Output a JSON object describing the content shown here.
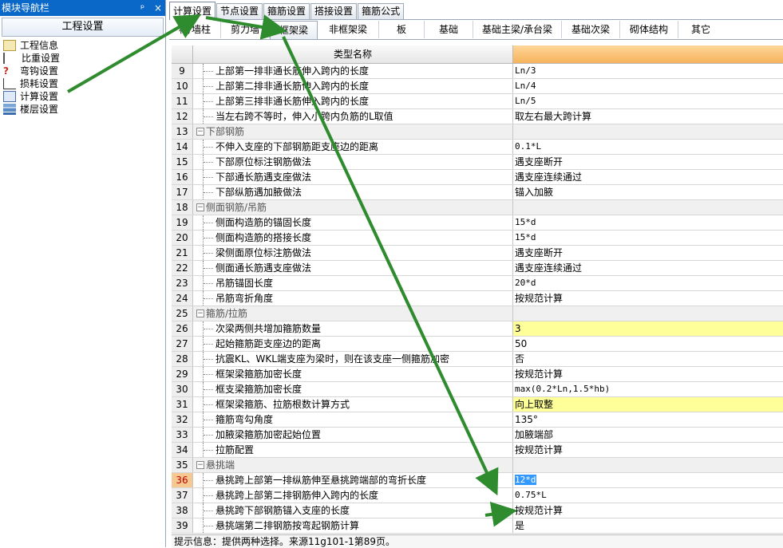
{
  "nav": {
    "title": "模块导航栏",
    "pin": "ᵖ",
    "close": "×",
    "section": "工程设置",
    "items": [
      {
        "label": "工程信息",
        "icon": "document-icon"
      },
      {
        "label": "比重设置",
        "icon": "scale-icon"
      },
      {
        "label": "弯钩设置",
        "icon": "hook-icon"
      },
      {
        "label": "损耗设置",
        "icon": "chart-icon"
      },
      {
        "label": "计算设置",
        "icon": "calculator-icon"
      },
      {
        "label": "楼层设置",
        "icon": "floors-icon"
      }
    ]
  },
  "tabs_top": [
    "计算设置",
    "节点设置",
    "箍筋设置",
    "搭接设置",
    "箍筋公式"
  ],
  "tabs_sub": [
    "柱/墙柱",
    "剪力墙",
    "框架梁",
    "非框架梁",
    "板",
    "基础",
    "基础主梁/承台梁",
    "基础次梁",
    "砌体结构",
    "其它"
  ],
  "grid": {
    "header": "类型名称",
    "rows": [
      {
        "num": "9",
        "name": "上部第一排非通长筋伸入跨内的长度",
        "value": "Ln/3"
      },
      {
        "num": "10",
        "name": "上部第二排非通长筋伸入跨内的长度",
        "value": "Ln/4"
      },
      {
        "num": "11",
        "name": "上部第三排非通长筋伸入跨内的长度",
        "value": "Ln/5"
      },
      {
        "num": "12",
        "name": "当左右跨不等时，伸入小跨内负筋的L取值",
        "value": "取左右最大跨计算"
      },
      {
        "num": "13",
        "name": "下部钢筋",
        "value": ""
      },
      {
        "num": "14",
        "name": "不伸入支座的下部钢筋距支座边的距离",
        "value": "0.1*L"
      },
      {
        "num": "15",
        "name": "下部原位标注钢筋做法",
        "value": "遇支座断开"
      },
      {
        "num": "16",
        "name": "下部通长筋遇支座做法",
        "value": "遇支座连续通过"
      },
      {
        "num": "17",
        "name": "下部纵筋遇加腋做法",
        "value": "锚入加腋"
      },
      {
        "num": "18",
        "name": "侧面钢筋/吊筋",
        "value": ""
      },
      {
        "num": "19",
        "name": "侧面构造筋的锚固长度",
        "value": "15*d"
      },
      {
        "num": "20",
        "name": "侧面构造筋的搭接长度",
        "value": "15*d"
      },
      {
        "num": "21",
        "name": "梁侧面原位标注筋做法",
        "value": "遇支座断开"
      },
      {
        "num": "22",
        "name": "侧面通长筋遇支座做法",
        "value": "遇支座连续通过"
      },
      {
        "num": "23",
        "name": "吊筋锚固长度",
        "value": "20*d"
      },
      {
        "num": "24",
        "name": "吊筋弯折角度",
        "value": "按规范计算"
      },
      {
        "num": "25",
        "name": "箍筋/拉筋",
        "value": ""
      },
      {
        "num": "26",
        "name": "次梁两侧共增加箍筋数量",
        "value": "3"
      },
      {
        "num": "27",
        "name": "起始箍筋距支座边的距离",
        "value": "50"
      },
      {
        "num": "28",
        "name": "抗震KL、WKL端支座为梁时，则在该支座一侧箍筋加密",
        "value": "否"
      },
      {
        "num": "29",
        "name": "框架梁箍筋加密长度",
        "value": "按规范计算"
      },
      {
        "num": "30",
        "name": "框支梁箍筋加密长度",
        "value": "max(0.2*Ln,1.5*hb)"
      },
      {
        "num": "31",
        "name": "框架梁箍筋、拉筋根数计算方式",
        "value": "向上取整"
      },
      {
        "num": "32",
        "name": "箍筋弯勾角度",
        "value": "135°"
      },
      {
        "num": "33",
        "name": "加腋梁箍筋加密起始位置",
        "value": "加腋端部"
      },
      {
        "num": "34",
        "name": "拉筋配置",
        "value": "按规范计算"
      },
      {
        "num": "35",
        "name": "悬挑端",
        "value": ""
      },
      {
        "num": "36",
        "name": "悬挑跨上部第一排纵筋伸至悬挑跨端部的弯折长度",
        "value": "12*d"
      },
      {
        "num": "37",
        "name": "悬挑跨上部第二排钢筋伸入跨内的长度",
        "value": "0.75*L"
      },
      {
        "num": "38",
        "name": "悬挑跨下部钢筋锚入支座的长度",
        "value": "按规范计算"
      },
      {
        "num": "39",
        "name": "悬挑端第二排钢筋按弯起钢筋计算",
        "value": "是"
      }
    ]
  },
  "status": "提示信息：提供两种选择。来源11g101-1第89页。",
  "colors": {
    "arrow": "#2e8b2e",
    "title_bar": "#0a68c8",
    "header_accent": "#f5b25b",
    "highlight_row": "#ffff99"
  }
}
